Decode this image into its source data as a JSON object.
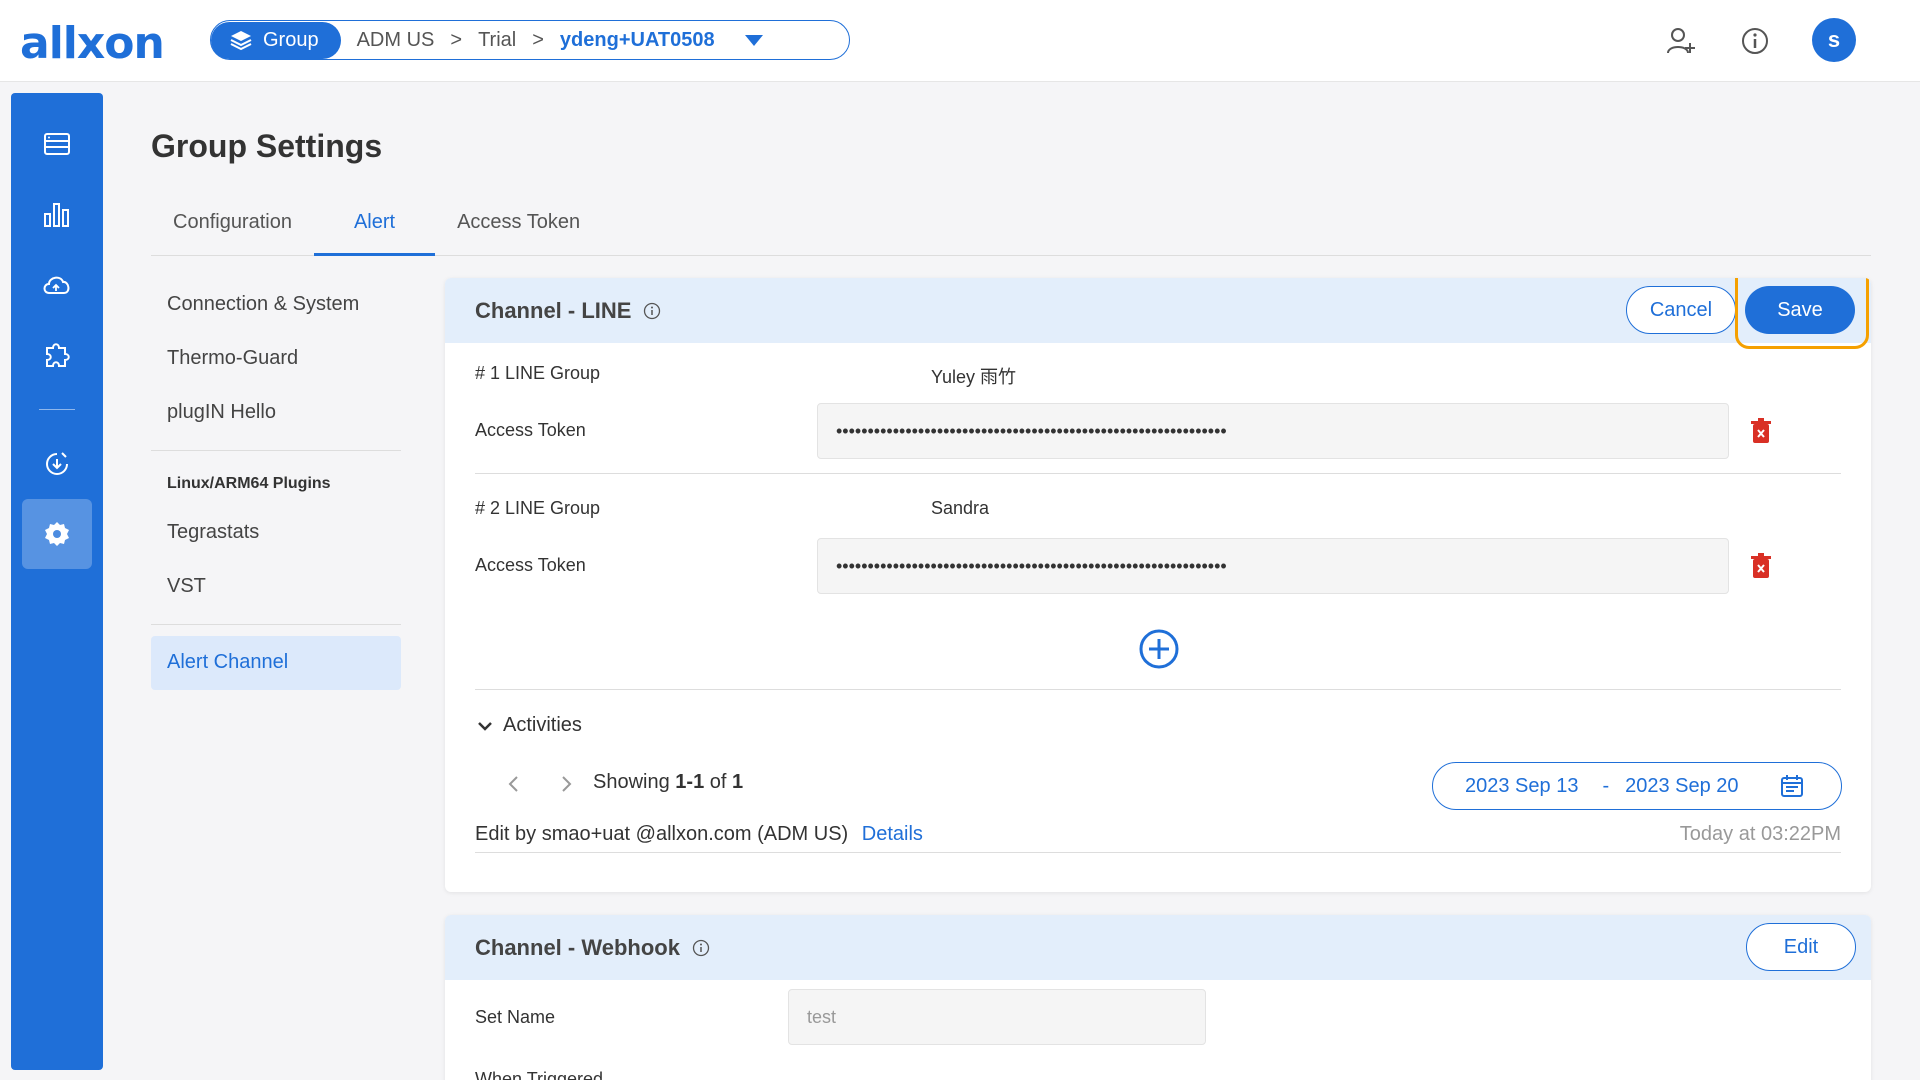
{
  "app": {
    "logo_text": "allxon",
    "avatar_initial": "s"
  },
  "breadcrumb": {
    "scope": "Group",
    "items": [
      "ADM US",
      "Trial",
      "ydeng+UAT0508"
    ],
    "separator": ">"
  },
  "header_icons": [
    "add-user-icon",
    "info-icon"
  ],
  "rail": [
    "devices-icon",
    "dashboard-icon",
    "cloud-sync-icon",
    "plugin-icon",
    "ota-icon",
    "settings-icon"
  ],
  "page": {
    "title": "Group Settings",
    "tabs": [
      "Configuration",
      "Alert",
      "Access Token"
    ],
    "active_tab": "Alert"
  },
  "subnav": {
    "items": [
      "Connection & System",
      "Thermo-Guard",
      "plugIN Hello"
    ],
    "section_heading": "Linux/ARM64 Plugins",
    "section_items": [
      "Tegrastats",
      "VST"
    ],
    "active_item": "Alert Channel"
  },
  "line_card": {
    "title": "Channel - LINE",
    "cancel_label": "Cancel",
    "save_label": "Save",
    "groups": [
      {
        "label": "# 1 LINE Group",
        "name": "Yuley 雨竹",
        "token_label": "Access Token",
        "token_value": "••••••••••••••••••••••••••••••••••••••••••••••••••••••••••••••"
      },
      {
        "label": "# 2 LINE Group",
        "name": "Sandra",
        "token_label": "Access Token",
        "token_value": "••••••••••••••••••••••••••••••••••••••••••••••••••••••••••••••"
      }
    ],
    "activities": {
      "title": "Activities",
      "showing_prefix": "Showing ",
      "showing_range": "1-1",
      "showing_of": " of ",
      "showing_total": "1",
      "date_from": "2023 Sep 13",
      "date_sep": "-",
      "date_to": "2023 Sep 20",
      "entry_text": "Edit by smao+uat @allxon.com (ADM US)",
      "entry_link": "Details",
      "entry_time": "Today at 03:22PM"
    }
  },
  "webhook_card": {
    "title": "Channel - Webhook",
    "edit_label": "Edit",
    "set_name_label": "Set Name",
    "set_name_value": "test",
    "when_triggered_label": "When Triggered"
  },
  "colors": {
    "accent": "#1f6fd8",
    "highlight": "#f5a000",
    "delete": "#d93025"
  }
}
